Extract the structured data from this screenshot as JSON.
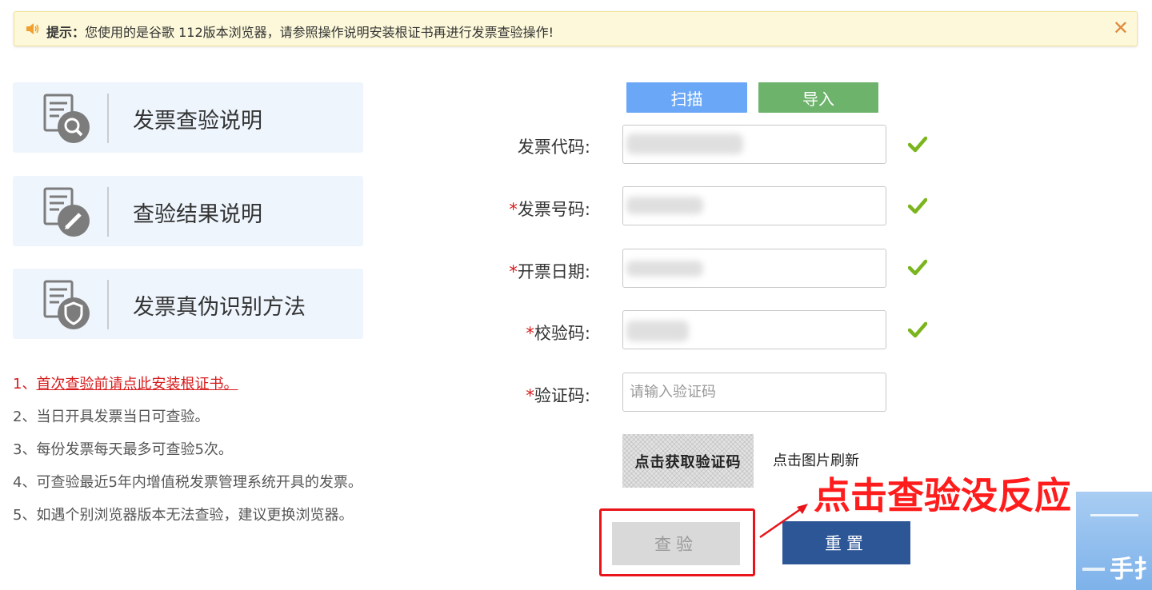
{
  "notice": {
    "label": "提示：",
    "text": "您使用的是谷歌 112版本浏览器，请参照操作说明安装根证书再进行发票查验操作!",
    "close": "✕"
  },
  "cards": [
    {
      "title": "发票查验说明",
      "icon": "invoice-search-icon"
    },
    {
      "title": "查验结果说明",
      "icon": "invoice-edit-icon"
    },
    {
      "title": "发票真伪识别方法",
      "icon": "invoice-shield-icon"
    }
  ],
  "tips": {
    "first_prefix": "1、",
    "first_link": "首次查验前请点此安装根证书。",
    "items": [
      "2、当日开具发票当日可查验。",
      "3、每份发票每天最多可查验5次。",
      "4、可查验最近5年内增值税发票管理系统开具的发票。",
      "5、如遇个别浏览器版本无法查验，建议更换浏览器。"
    ]
  },
  "form": {
    "scan_label": "扫描",
    "import_label": "导入",
    "required_mark": "*",
    "invoice_code_label": "发票代码:",
    "invoice_number_label": "发票号码:",
    "issue_date_label": "开票日期:",
    "check_code_label": "校验码:",
    "captcha_label": "验证码:",
    "captcha_placeholder": "请输入验证码",
    "captcha_image_text": "点击获取验证码",
    "captcha_refresh_hint": "点击图片刷新",
    "query_label": "查验",
    "reset_label": "重置"
  },
  "annotation": {
    "text": "点击查验没反应"
  },
  "corner_thumbnail": {
    "text": "手扌"
  },
  "colors": {
    "scan": "#6aa8f7",
    "import": "#6db36b",
    "reset": "#2d5697",
    "annotation": "#ff1c1c",
    "check": "#7ab51d"
  }
}
